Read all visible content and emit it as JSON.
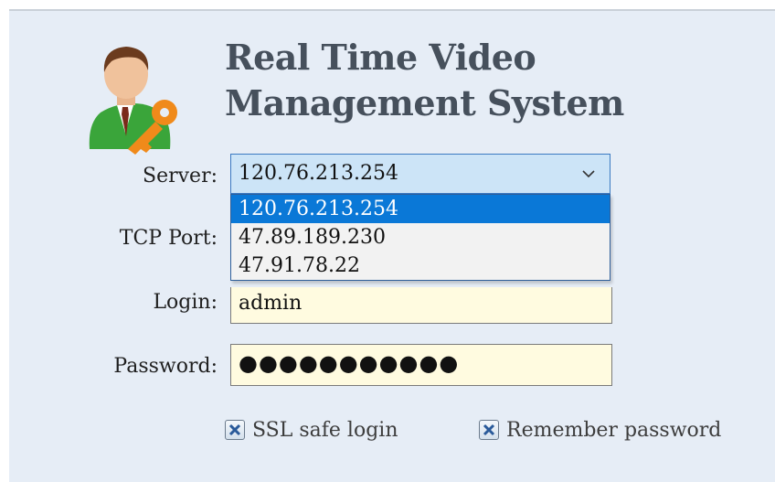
{
  "app": {
    "title_line1": "Real Time Video",
    "title_line2": "Management System",
    "logo_icon": "user-key-icon"
  },
  "form": {
    "server_label": "Server:",
    "server_value": "120.76.213.254",
    "server_options": [
      "120.76.213.254",
      "47.89.189.230",
      "47.91.78.22"
    ],
    "tcp_port_label": "TCP Port:",
    "login_label": "Login:",
    "login_value": "admin",
    "password_label": "Password:",
    "password_masked": "●●●●●●●●●●●",
    "ssl_label": "SSL safe login",
    "ssl_checked": true,
    "remember_label": "Remember password",
    "remember_checked": true
  },
  "colors": {
    "window_bg": "#e6edf6",
    "field_bg": "#fffbe0",
    "selection": "#0a78d7",
    "combo_bg": "#cce4f7"
  }
}
